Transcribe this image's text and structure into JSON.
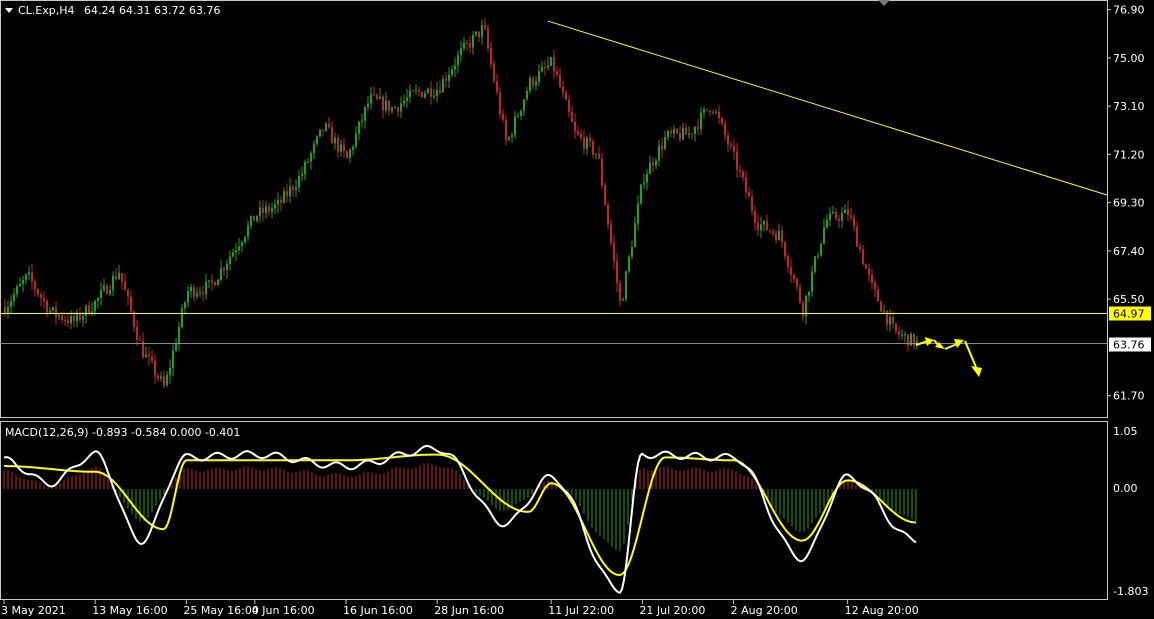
{
  "colors": {
    "background": "#000000",
    "frame": "#c8c8c8",
    "bull": "#22a022",
    "bear": "#c02828",
    "trendline": "#ffff00",
    "support_line": "#ffff00",
    "current_price_line": "#8a8a8a",
    "macd_line": "#ffffff",
    "signal_line": "#ffff00",
    "label_text": "#ffffff",
    "support_tag_bg": "#ffff00",
    "support_tag_text": "#000000",
    "price_tag_bg": "#ffffff",
    "price_tag_text": "#000000"
  },
  "header": {
    "collapse_icon": "triangle-down-icon",
    "symbol": "CL.Exp,H4",
    "ohlc": "64.24 64.31 63.72 63.76"
  },
  "price_panel": {
    "ticks": [
      "76.90",
      "75.00",
      "73.10",
      "71.20",
      "69.30",
      "67.40",
      "65.50",
      "61.70"
    ],
    "support_tag": "64.97",
    "price_tag": "63.76"
  },
  "macd_panel": {
    "label": "MACD(12,26,9) -0.893 -0.584 0.000 -0.401",
    "ticks": [
      "1.05",
      "0.00",
      "-1.803"
    ]
  },
  "time_axis": {
    "labels": [
      "3 May 2021",
      "13 May 16:00",
      "25 May 16:00",
      "4 Jun 16:00",
      "16 Jun 16:00",
      "28 Jun 16:00",
      "11 Jul 22:00",
      "21 Jul 20:00",
      "2 Aug 20:00",
      "12 Aug 20:00"
    ]
  },
  "chart_data": {
    "type": "candlestick",
    "symbol": "CL.Exp",
    "timeframe": "H4",
    "y_range": [
      60.9,
      77.2
    ],
    "support_level": 64.97,
    "current_price": 63.76,
    "trendline": [
      {
        "x_index": 0,
        "price": 76.45
      },
      {
        "x_index": 1,
        "price": 69.6
      }
    ],
    "price_path": [
      {
        "date": "3 May 2021",
        "price": 65.2
      },
      {
        "date": "5 May 2021",
        "price": 66.4
      },
      {
        "date": "7 May 2021",
        "price": 65.0
      },
      {
        "date": "11 May 2021",
        "price": 64.6
      },
      {
        "date": "13 May 16:00",
        "price": 65.4
      },
      {
        "date": "17 May 2021",
        "price": 66.6
      },
      {
        "date": "19 May 2021",
        "price": 63.5
      },
      {
        "date": "21 May 2021",
        "price": 62.0
      },
      {
        "date": "25 May 16:00",
        "price": 65.8
      },
      {
        "date": "27 May 2021",
        "price": 66.0
      },
      {
        "date": "31 May 2021",
        "price": 67.4
      },
      {
        "date": "4 Jun 16:00",
        "price": 68.8
      },
      {
        "date": "8 Jun 2021",
        "price": 69.2
      },
      {
        "date": "10 Jun 2021",
        "price": 70.4
      },
      {
        "date": "14 Jun 2021",
        "price": 72.3
      },
      {
        "date": "16 Jun 16:00",
        "price": 71.0
      },
      {
        "date": "18 Jun 2021",
        "price": 73.4
      },
      {
        "date": "22 Jun 2021",
        "price": 73.0
      },
      {
        "date": "24 Jun 2021",
        "price": 73.6
      },
      {
        "date": "28 Jun 16:00",
        "price": 73.8
      },
      {
        "date": "30 Jun 2021",
        "price": 75.2
      },
      {
        "date": "2 Jul 2021",
        "price": 76.2
      },
      {
        "date": "6 Jul 2021",
        "price": 71.6
      },
      {
        "date": "8 Jul 2021",
        "price": 74.0
      },
      {
        "date": "11 Jul 22:00",
        "price": 74.8
      },
      {
        "date": "13 Jul 2021",
        "price": 72.0
      },
      {
        "date": "15 Jul 2021",
        "price": 71.2
      },
      {
        "date": "19 Jul 2021",
        "price": 65.2
      },
      {
        "date": "21 Jul 20:00",
        "price": 70.3
      },
      {
        "date": "23 Jul 2021",
        "price": 71.9
      },
      {
        "date": "27 Jul 2021",
        "price": 72.0
      },
      {
        "date": "29 Jul 2021",
        "price": 73.2
      },
      {
        "date": "2 Aug 20:00",
        "price": 71.0
      },
      {
        "date": "4 Aug 2021",
        "price": 68.5
      },
      {
        "date": "6 Aug 2021",
        "price": 68.0
      },
      {
        "date": "9 Aug 2021",
        "price": 65.1
      },
      {
        "date": "11 Aug 2021",
        "price": 68.6
      },
      {
        "date": "12 Aug 20:00",
        "price": 68.9
      },
      {
        "date": "16 Aug 2021",
        "price": 66.0
      },
      {
        "date": "18 Aug 2021",
        "price": 64.2
      },
      {
        "date": "19 Aug 2021",
        "price": 63.76
      }
    ],
    "macd_y_range": [
      -1.9,
      1.15
    ],
    "macd": {
      "name": "MACD(12,26,9)",
      "params": "-0.893 -0.584 0.000 -0.401",
      "macd_path": [
        {
          "date": "3 May 2021",
          "value": 0.5
        },
        {
          "date": "7 May 2021",
          "value": 0.1
        },
        {
          "date": "13 May 16:00",
          "value": 0.6
        },
        {
          "date": "19 May 2021",
          "value": -0.9
        },
        {
          "date": "25 May 16:00",
          "value": 0.55
        },
        {
          "date": "4 Jun 16:00",
          "value": 0.6
        },
        {
          "date": "16 Jun 16:00",
          "value": 0.4
        },
        {
          "date": "28 Jun 16:00",
          "value": 0.7
        },
        {
          "date": "6 Jul 2021",
          "value": -0.6
        },
        {
          "date": "11 Jul 22:00",
          "value": 0.2
        },
        {
          "date": "19 Jul 2021",
          "value": -1.75
        },
        {
          "date": "21 Jul 20:00",
          "value": 0.6
        },
        {
          "date": "2 Aug 20:00",
          "value": 0.55
        },
        {
          "date": "9 Aug 2021",
          "value": -1.2
        },
        {
          "date": "12 Aug 20:00",
          "value": 0.2
        },
        {
          "date": "19 Aug 2021",
          "value": -0.893
        }
      ],
      "signal_path": [
        {
          "date": "3 May 2021",
          "value": 0.4
        },
        {
          "date": "13 May 16:00",
          "value": 0.3
        },
        {
          "date": "21 May 2021",
          "value": -0.7
        },
        {
          "date": "25 May 16:00",
          "value": 0.5
        },
        {
          "date": "16 Jun 16:00",
          "value": 0.5
        },
        {
          "date": "28 Jun 16:00",
          "value": 0.6
        },
        {
          "date": "8 Jul 2021",
          "value": -0.4
        },
        {
          "date": "11 Jul 22:00",
          "value": 0.1
        },
        {
          "date": "19 Jul 2021",
          "value": -1.5
        },
        {
          "date": "23 Jul 2021",
          "value": 0.55
        },
        {
          "date": "2 Aug 20:00",
          "value": 0.5
        },
        {
          "date": "9 Aug 2021",
          "value": -0.9
        },
        {
          "date": "12 Aug 20:00",
          "value": 0.15
        },
        {
          "date": "19 Aug 2021",
          "value": -0.584
        }
      ]
    }
  }
}
